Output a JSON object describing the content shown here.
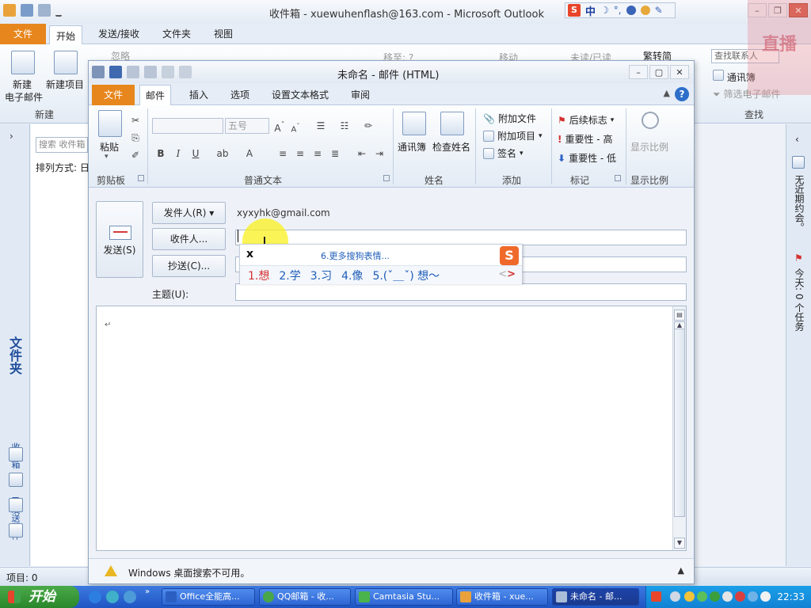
{
  "outlook": {
    "title": "收件箱 - xuewuhenflash@163.com  -  Microsoft Outlook",
    "file_tab": "文件",
    "tabs": [
      "开始",
      "发送/接收",
      "文件夹",
      "视图"
    ],
    "ribbon": {
      "new_email_line1": "新建",
      "new_email_line2": "电子邮件",
      "new_items": "新建项目",
      "group_new": "新建",
      "ignore": "忽略",
      "move_to": "移至: ?",
      "move": "移动",
      "unread_read": "未读/已读",
      "trad_simp": "繁转简",
      "search_contacts": "查找联系人",
      "address_book": "通讯簿",
      "filter_email": "筛选电子邮件",
      "group_find": "查找"
    },
    "nav": {
      "folder_pane": "文件夹",
      "inbox": "收件箱",
      "sent": "已发送邮件"
    },
    "list": {
      "search_placeholder": "搜索 收件箱",
      "sort_label": "排列方式: 日"
    },
    "todo": {
      "no_appointments": "无近期约会。",
      "today_tasks": "今天: 0 个任务"
    },
    "status": "项目: 0",
    "watermark": "直播"
  },
  "sogou_bar": {
    "logo": "S",
    "mode": "中"
  },
  "compose": {
    "title": "未命名 - 邮件 (HTML)",
    "file_tab": "文件",
    "tabs": [
      "邮件",
      "插入",
      "选项",
      "设置文本格式",
      "审阅"
    ],
    "help": "?",
    "ribbon": {
      "paste": "粘贴",
      "clipboard": "剪贴板",
      "font_size": "五号",
      "bold": "B",
      "italic": "I",
      "underline": "U",
      "basic_text": "普通文本",
      "address_book": "通讯簿",
      "check_names": "检查姓名",
      "names": "姓名",
      "attach_file": "附加文件",
      "attach_item": "附加项目",
      "signature": "签名",
      "include": "添加",
      "follow_up": "后续标志",
      "importance_high": "重要性 - 高",
      "importance_low": "重要性 - 低",
      "tags": "标记",
      "zoom": "显示比例",
      "zoom_group": "显示比例"
    },
    "send": "发送(S)",
    "from_button": "发件人(R) ▾",
    "from_address": "xyxyhk@gmail.com",
    "to_button": "收件人...",
    "cc_button": "抄送(C)...",
    "subject_label": "主题(U):",
    "to_value": "",
    "cc_value": "",
    "subject_value": "",
    "body_mark": "↵",
    "infobar": "Windows 桌面搜索不可用。"
  },
  "ime": {
    "input": "x",
    "more": "6.更多搜狗表情...",
    "logo": "S",
    "candidates": [
      "1.想",
      "2.学",
      "3.习",
      "4.像",
      "5.(ˇ＿ˇ)  想～"
    ]
  },
  "taskbar": {
    "start": "开始",
    "tasks": [
      "Office全能高...",
      "QQ邮箱 - 收...",
      "Camtasia Stu...",
      "收件箱 - xue...",
      "未命名 - 邮..."
    ],
    "clock": "22:33"
  },
  "colors": {
    "file_tab": "#e7861d",
    "taskbar": "#1e55c4",
    "start": "#2a862a",
    "ime_highlight": "#d43131",
    "cursor_halo": "#faf01e"
  }
}
